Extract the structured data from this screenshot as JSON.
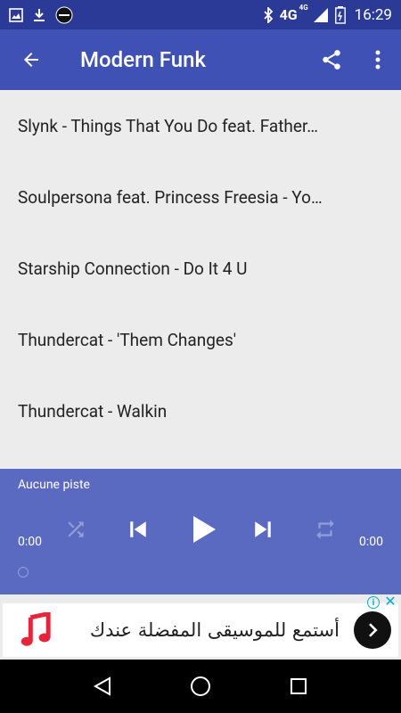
{
  "status_bar": {
    "network": "4G",
    "network_sup": "4G",
    "time": "16:29"
  },
  "app_bar": {
    "title": "Modern Funk"
  },
  "tracks": [
    "Slynk - Things That You Do feat. Father…",
    "Soulpersona feat. Princess Freesia - Yo…",
    "Starship Connection - Do It 4 U",
    "Thundercat - 'Them Changes'",
    "Thundercat - Walkin"
  ],
  "player": {
    "track_name": "Aucune piste",
    "time_elapsed": "0:00",
    "time_total": "0:00"
  },
  "ad": {
    "text": "أستمع للموسيقى المفضلة عندك"
  },
  "colors": {
    "status_bar": "#2b3a96",
    "app_bar": "#3f51b5",
    "player": "#5b6ac1",
    "ad_icon": "#e5253a"
  }
}
